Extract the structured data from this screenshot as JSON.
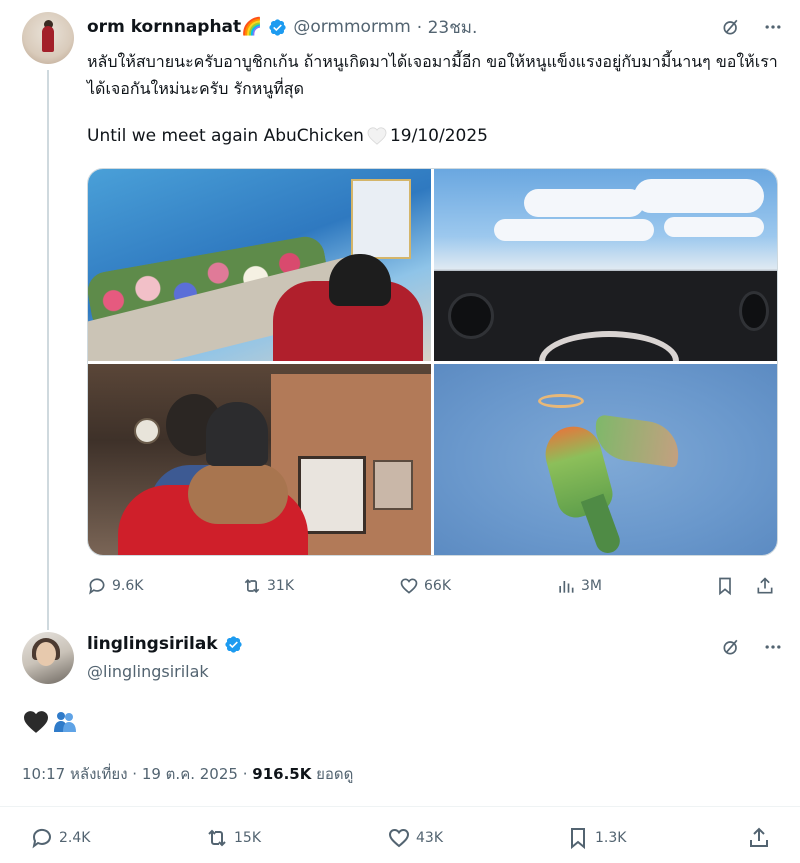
{
  "tweet1": {
    "display_name": "orm kornnaphat🌈",
    "handle": "@ormmormm",
    "time": "· 23ชม.",
    "text_th": "หลับให้สบายนะครับอาบูชิกเก้น ถ้าหนูเกิดมาได้เจอมามี้อีก ขอให้หนูแข็งแรงอยู่กับมามี้นานๆ ขอให้เราได้เจอกันใหม่นะครับ รักหนูที่สุด",
    "text_en": "Until we meet again AbuChicken",
    "date_text": "19/10/2025",
    "stats": {
      "replies": "9.6K",
      "retweets": "31K",
      "likes": "66K",
      "views": "3M"
    }
  },
  "tweet2": {
    "display_name": "linglingsirilak",
    "handle": "@linglingsirilak",
    "text": "🖤🫂",
    "time": "10:17 หลังเที่ยง · 19 ต.ค. 2025 ·",
    "views_count": "916.5K",
    "views_label": "ยอดดู",
    "stats": {
      "replies": "2.4K",
      "retweets": "15K",
      "likes": "43K",
      "bookmarks": "1.3K"
    }
  },
  "colors": {
    "text_primary": "#0f1419",
    "text_secondary": "#536471",
    "verified": "#1d9bf0",
    "border": "#cfd9de"
  },
  "icons": [
    "grok-icon",
    "more-icon",
    "reply-icon",
    "retweet-icon",
    "like-icon",
    "views-icon",
    "bookmark-icon",
    "share-icon",
    "verified-badge-icon"
  ]
}
